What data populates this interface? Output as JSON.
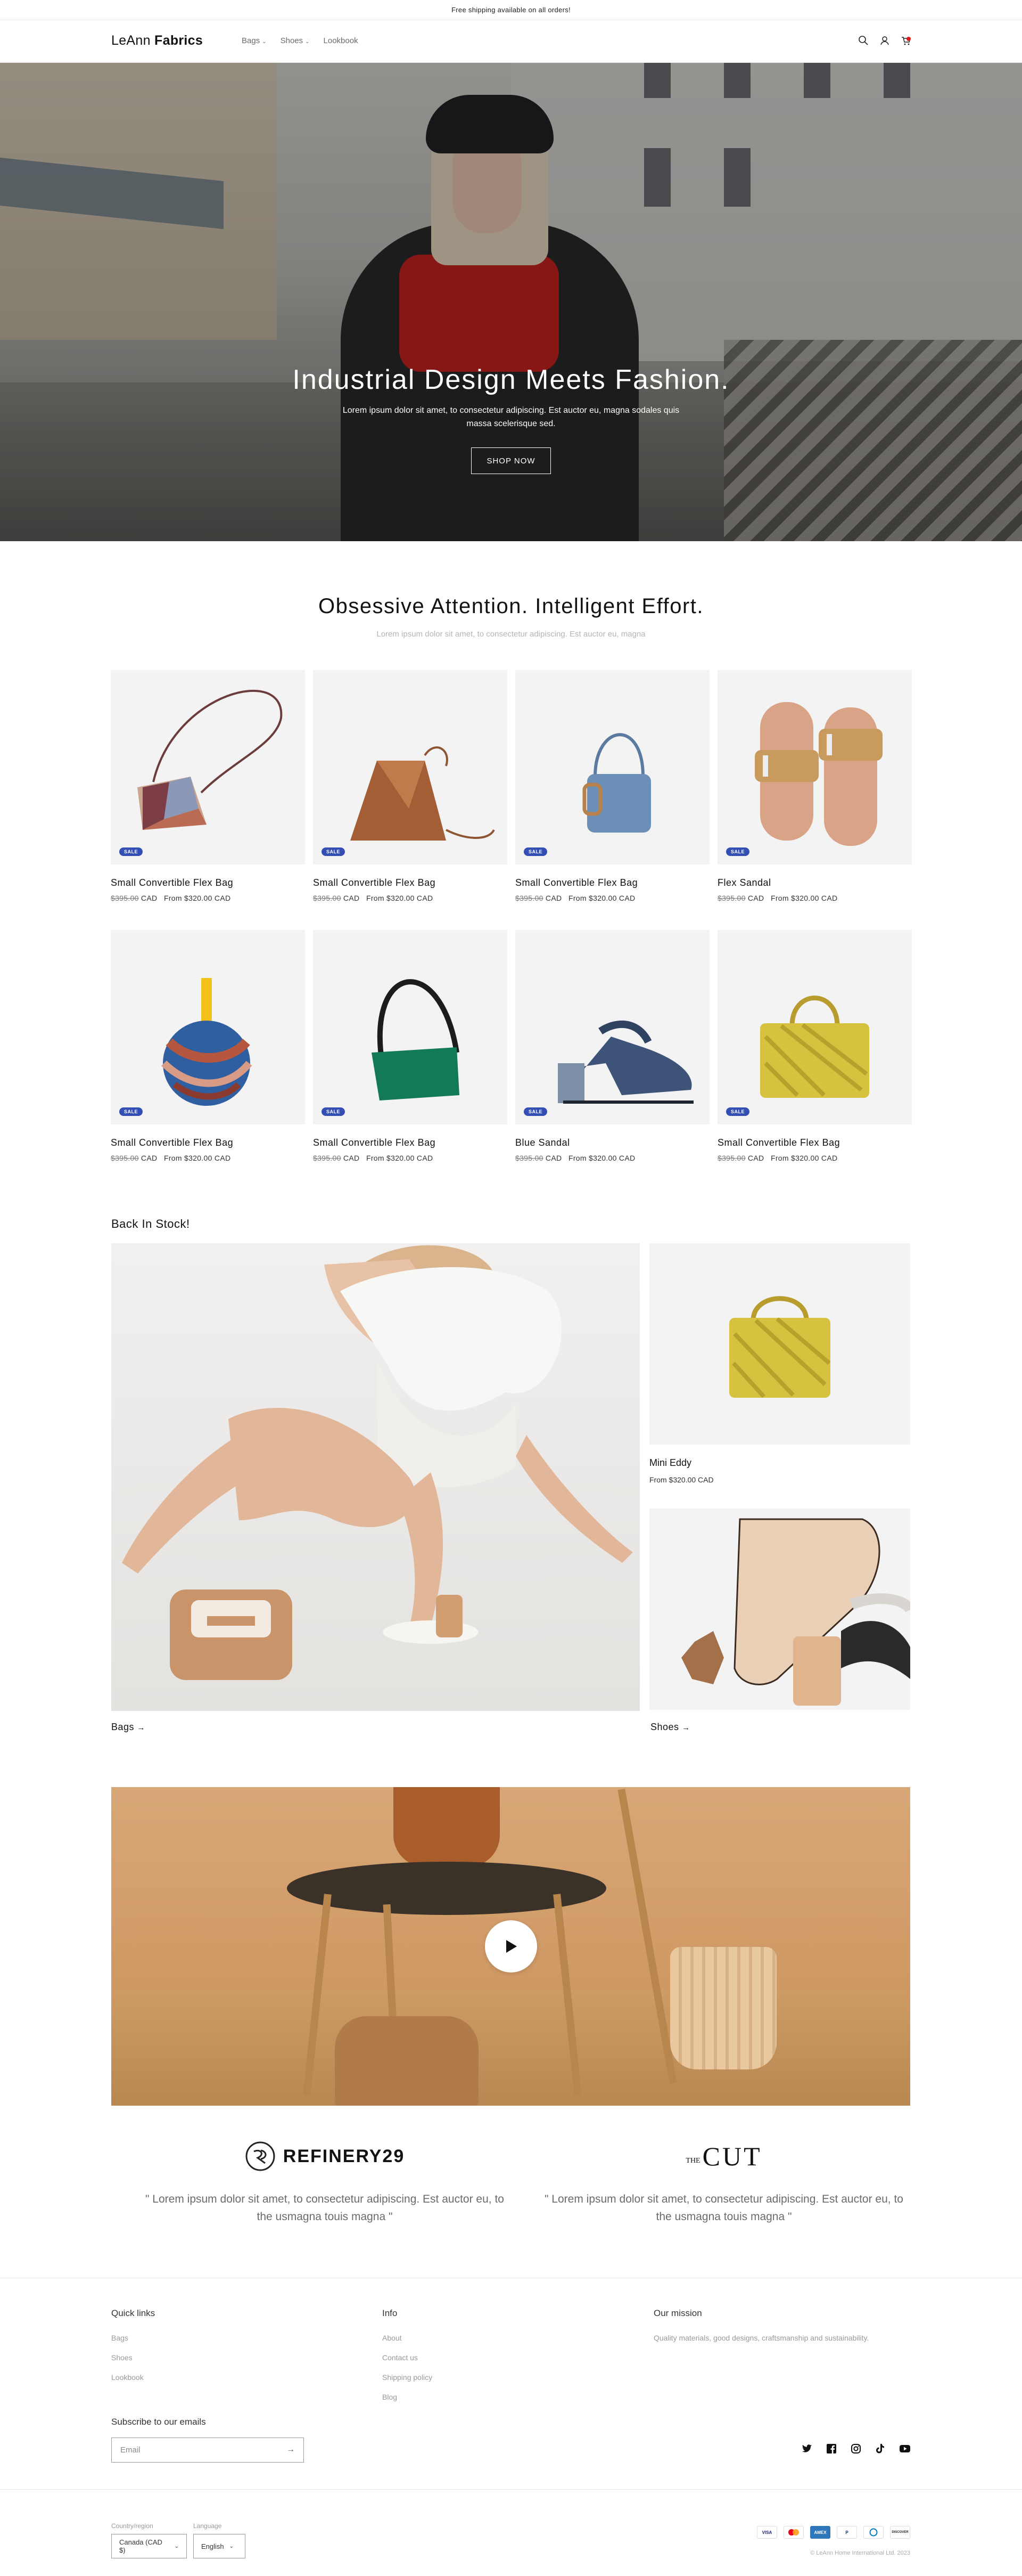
{
  "announcement": "Free shipping available on all orders!",
  "brand": {
    "name_light": "LeAnn ",
    "name_bold": "Fabrics"
  },
  "nav": [
    {
      "label": "Bags",
      "dropdown": true
    },
    {
      "label": "Shoes",
      "dropdown": true
    },
    {
      "label": "Lookbook",
      "dropdown": false
    }
  ],
  "hero": {
    "title": "Industrial Design Meets Fashion.",
    "subtitle": "Lorem ipsum dolor sit amet, to consectetur adipiscing. Est auctor eu, magna sodales quis massa scelerisque sed.",
    "cta": "SHOP NOW"
  },
  "collection": {
    "title": "Obsessive Attention. Intelligent Effort.",
    "subtitle": "Lorem ipsum dolor sit amet, to consectetur adipiscing. Est auctor eu, magna",
    "badge": "SALE",
    "products": [
      {
        "name": "Small Convertible Flex Bag",
        "compare_price": "$395.00",
        "currency": "CAD",
        "price": "From $320.00 CAD"
      },
      {
        "name": "Small Convertible Flex Bag",
        "compare_price": "$395.00",
        "currency": "CAD",
        "price": "From $320.00 CAD"
      },
      {
        "name": "Small Convertible Flex Bag",
        "compare_price": "$395.00",
        "currency": "CAD",
        "price": "From $320.00 CAD"
      },
      {
        "name": "Flex Sandal",
        "compare_price": "$395.00",
        "currency": "CAD",
        "price": "From $320.00 CAD"
      },
      {
        "name": "Small Convertible Flex Bag",
        "compare_price": "$395.00",
        "currency": "CAD",
        "price": "From $320.00 CAD"
      },
      {
        "name": "Small Convertible Flex Bag",
        "compare_price": "$395.00",
        "currency": "CAD",
        "price": "From $320.00 CAD"
      },
      {
        "name": "Blue Sandal",
        "compare_price": "$395.00",
        "currency": "CAD",
        "price": "From $320.00 CAD"
      },
      {
        "name": "Small Convertible Flex Bag",
        "compare_price": "$395.00",
        "currency": "CAD",
        "price": "From $320.00 CAD"
      }
    ]
  },
  "back_in_stock": {
    "title": "Back In Stock!",
    "bags_link": "Bags",
    "shoes_link": "Shoes",
    "featured_name": "Mini Eddy",
    "featured_price": "From $320.00 CAD"
  },
  "press": [
    {
      "logo": "REFINERY29",
      "quote": "\" Lorem ipsum dolor sit amet, to consectetur adipiscing. Est auctor eu, to the usmagna touis magna \""
    },
    {
      "logo_small": "THE",
      "logo": "CUT",
      "quote": "\" Lorem ipsum dolor sit amet, to consectetur adipiscing. Est auctor eu, to the usmagna touis magna \""
    }
  ],
  "footer": {
    "quick_links": {
      "title": "Quick links",
      "items": [
        "Bags",
        "Shoes",
        "Lookbook"
      ]
    },
    "info": {
      "title": "Info",
      "items": [
        "About",
        "Contact us",
        "Shipping policy",
        "Blog"
      ]
    },
    "mission": {
      "title": "Our mission",
      "text": "Quality materials, good designs, craftsmanship and sustainability."
    },
    "subscribe_title": "Subscribe to our emails",
    "email_placeholder": "Email",
    "country_label": "Country/region",
    "country_value": "Canada (CAD $)",
    "language_label": "Language",
    "language_value": "English",
    "payments": [
      "VISA",
      "MC",
      "AMEX",
      "P",
      "DC",
      "DISCOVER"
    ],
    "copyright": "© LeAnn Home International Ltd. 2023"
  },
  "colors": {
    "badge": "#334fb4",
    "muted": "#b5b5b5",
    "text": "#121212"
  }
}
